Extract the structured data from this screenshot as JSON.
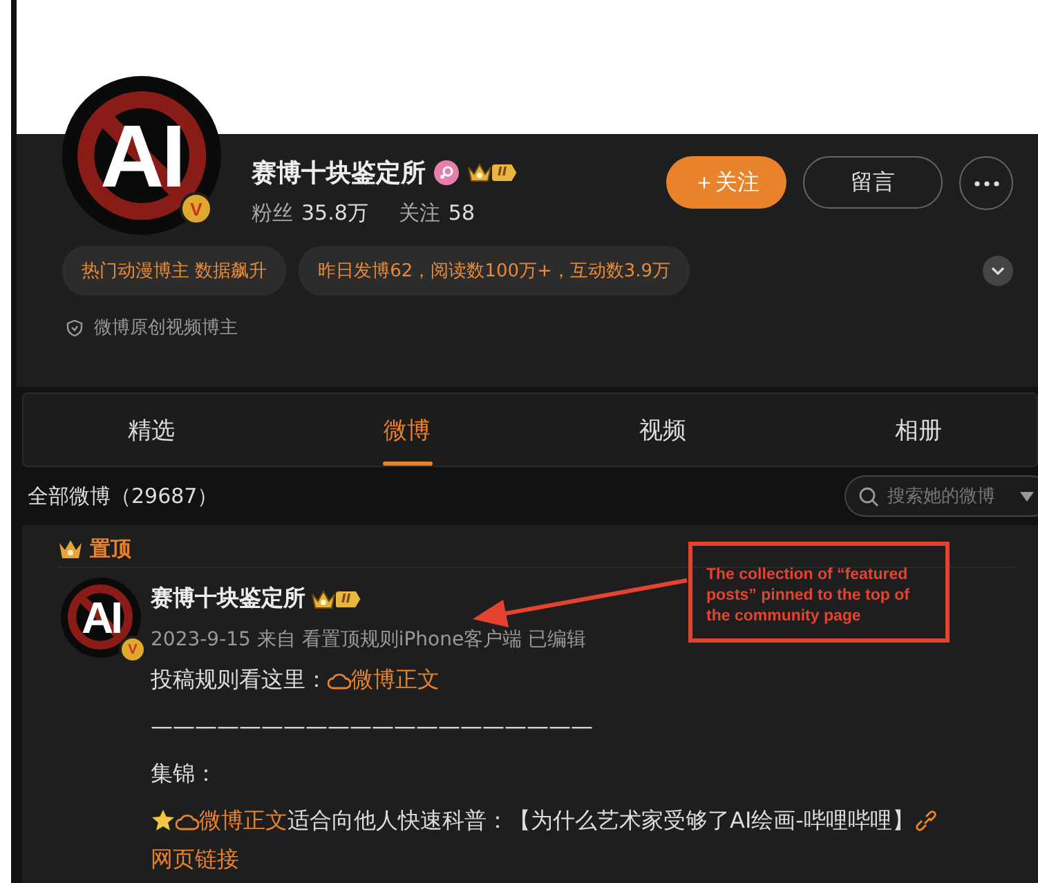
{
  "profile": {
    "avatar_text": "AI",
    "verified_badge": "V",
    "name": "赛博十块鉴定所",
    "level_badge": "II",
    "stats": [
      {
        "label": "粉丝",
        "value": "35.8万"
      },
      {
        "label": "关注",
        "value": "58"
      }
    ],
    "follow_button": "＋关注",
    "message_button": "留言",
    "tags": [
      "热门动漫博主 数据飙升",
      "昨日发博62，阅读数100万+，互动数3.9万"
    ],
    "description": "微博原创视频博主"
  },
  "tabs": [
    {
      "label": "精选",
      "selected": false
    },
    {
      "label": "微博",
      "selected": true
    },
    {
      "label": "视频",
      "selected": false
    },
    {
      "label": "相册",
      "selected": false
    }
  ],
  "feed_header": {
    "title": "全部微博（29687）",
    "search": {
      "placeholder": "搜索她的微博"
    }
  },
  "pinned_post": {
    "pinned_label": "置顶",
    "avatar_text": "AI",
    "verified_badge": "V",
    "author": "赛博十块鉴定所",
    "level_badge": "II",
    "meta": "2023-9-15 来自 看置顶规则iPhone客户端 已编辑",
    "paragraphs": [
      [
        {
          "kind": "text",
          "text": "投稿规则看这里："
        },
        {
          "kind": "weibo_link",
          "text": "微博正文"
        }
      ],
      [
        {
          "kind": "text",
          "text": "————————————————————"
        }
      ],
      [
        {
          "kind": "text",
          "text": "集锦："
        }
      ],
      [
        {
          "kind": "star"
        },
        {
          "kind": "weibo_link",
          "text": "微博正文"
        },
        {
          "kind": "text",
          "text": "适合向他人快速科普：【为什么艺术家受够了AI绘画-哔哩哔哩】"
        },
        {
          "kind": "web_link",
          "text": "网页链接"
        }
      ]
    ]
  },
  "annotation": {
    "text": "The collection of “featured posts” pinned to the top of the community page"
  }
}
